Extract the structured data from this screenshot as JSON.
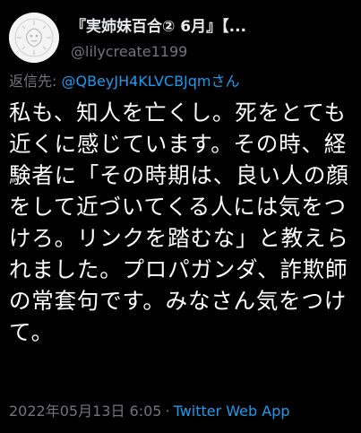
{
  "tweet": {
    "display_name": "『実姉妹百合② 6月』【...",
    "username": "@lilycreate1199",
    "reply_prefix": "返信先: ",
    "reply_target": "@QBeyJH4KLVCBJqmさん",
    "text": "私も、知人を亡くし。死をとても近くに感じています。その時、経験者に「その時期は、良い人の顔をして近づいてくる人には気をつけろ。リンクを踏むな」と教えられました。プロパガンダ、詐欺師の常套句です。みなさん気をつけて。",
    "timestamp": "2022年05月13日 6:05",
    "separator": "·",
    "source": "Twitter Web App"
  },
  "icons": {
    "avatar": "avatar-icon"
  },
  "colors": {
    "background": "#000000",
    "text": "#ffffff",
    "secondary": "#71767b",
    "link": "#1d9bf0"
  }
}
